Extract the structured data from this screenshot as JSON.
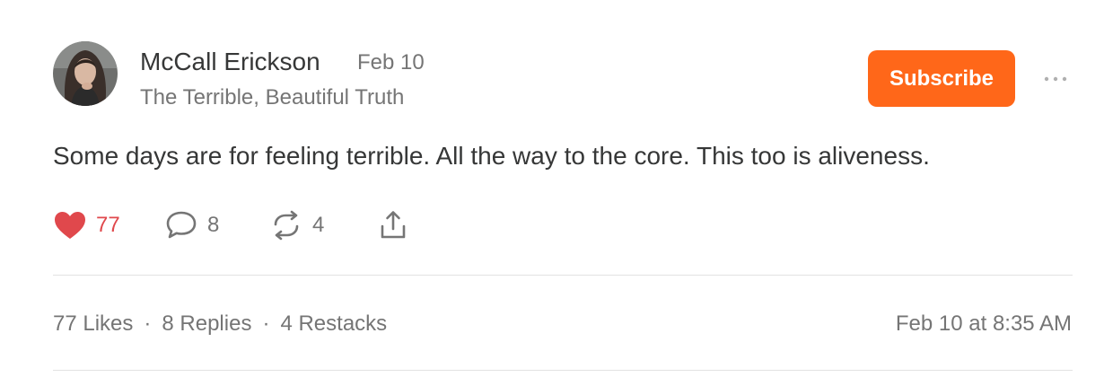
{
  "post": {
    "author": {
      "name": "McCall Erickson",
      "publication": "The Terrible, Beautiful Truth",
      "avatar_icon": "author-avatar"
    },
    "date": "Feb 10",
    "subscribe_label": "Subscribe",
    "more_icon": "ellipsis-icon",
    "body": "Some days are for feeling terrible. All the way to the core. This too is aliveness.",
    "actions": {
      "likes": "77",
      "replies": "8",
      "restacks": "4"
    },
    "stats": {
      "likes": "77 Likes",
      "replies": "8 Replies",
      "restacks": "4 Restacks",
      "separator": "·"
    },
    "timestamp": "Feb 10 at 8:35 AM"
  },
  "colors": {
    "accent": "#ff6719",
    "like": "#e0484c",
    "text": "#363737",
    "muted": "#757575",
    "divider": "#e2e2e2"
  }
}
